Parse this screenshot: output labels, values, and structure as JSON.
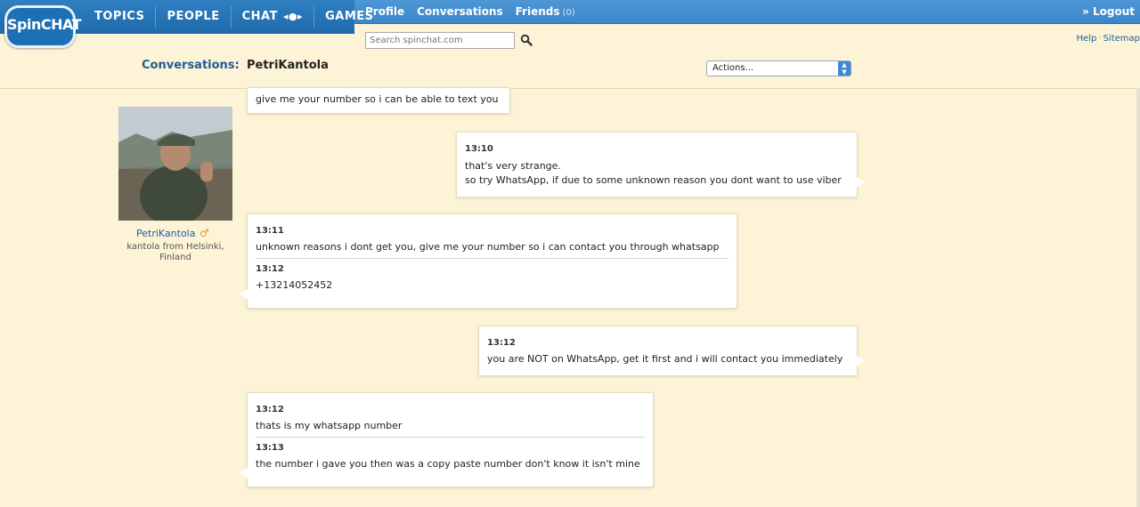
{
  "logo": {
    "text": "SpinCHAT"
  },
  "mainnav": {
    "topics": "TOPICS",
    "people": "PEOPLE",
    "chat": "CHAT",
    "games": "GAMES"
  },
  "subnav": {
    "profile": "Profile",
    "conversations": "Conversations",
    "friends": "Friends",
    "friends_count": "(0)",
    "logout": "» Logout"
  },
  "search": {
    "placeholder": "Search spinchat.com"
  },
  "helplinks": {
    "help": "Help",
    "sitemap": "Sitemap"
  },
  "conversation": {
    "label": "Conversations:",
    "name": "PetriKantola",
    "actions": "Actions..."
  },
  "profile": {
    "name": "PetriKantola",
    "location": "kantola from Helsinki, Finland"
  },
  "messages": [
    {
      "side": "left",
      "entries": [
        {
          "time": "",
          "text": [
            "give me your number so i can be able to text you"
          ]
        }
      ]
    },
    {
      "side": "right",
      "entries": [
        {
          "time": "13:10",
          "text": [
            "that's very strange.",
            "so try WhatsApp, if due to some unknown reason you dont want to use viber"
          ]
        }
      ]
    },
    {
      "side": "left",
      "entries": [
        {
          "time": "13:11",
          "text": [
            "unknown reasons i dont get you, give me your number so i can contact you through whatsapp"
          ]
        },
        {
          "time": "13:12",
          "text": [
            "+13214052452"
          ]
        }
      ]
    },
    {
      "side": "right",
      "entries": [
        {
          "time": "13:12",
          "text": [
            "you are NOT on WhatsApp, get it first and i will contact you immediately"
          ]
        }
      ]
    },
    {
      "side": "left",
      "entries": [
        {
          "time": "13:12",
          "text": [
            "thats is my whatsapp number"
          ]
        },
        {
          "time": "13:13",
          "text": [
            "the number i gave you then was a copy paste number don't know it isn't mine"
          ]
        }
      ]
    }
  ],
  "colors": {
    "nav_blue": "#1e6aab",
    "subnav_blue": "#3b86c9",
    "page_bg": "#fdf3d6",
    "link": "#1d5e99"
  }
}
